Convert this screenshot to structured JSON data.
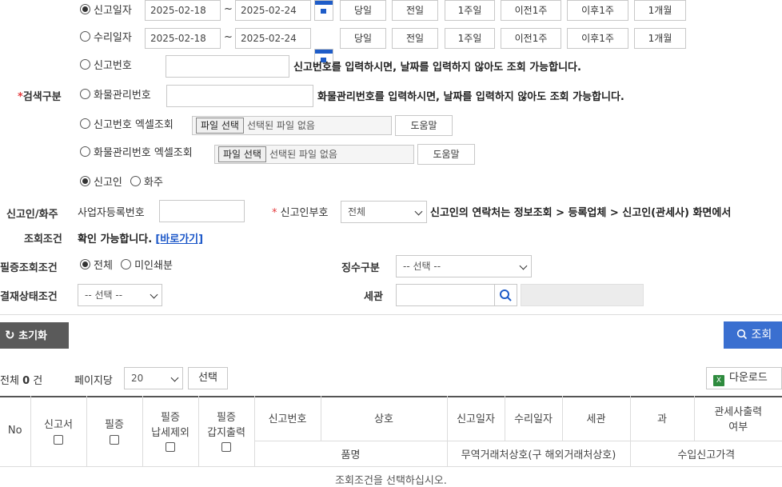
{
  "search_type": {
    "label": "검색구분",
    "report_date": {
      "radio_label": "신고일자",
      "from": "2025-02-18",
      "tilde": "~",
      "to": "2025-02-24"
    },
    "accept_date": {
      "radio_label": "수리일자",
      "from": "2025-02-18",
      "tilde": "~",
      "to": "2025-02-24"
    },
    "quick_buttons": [
      "당일",
      "전일",
      "1주일",
      "이전1주",
      "이후1주",
      "1개월"
    ],
    "report_no": {
      "radio_label": "신고번호",
      "notice": "신고번호를 입력하시면, 날짜를 입력하지 않아도 조회 가능합니다."
    },
    "cargo_no": {
      "radio_label": "화물관리번호",
      "notice": "화물관리번호를 입력하시면, 날짜를 입력하지 않아도 조회 가능합니다."
    },
    "report_excel": {
      "radio_label": "신고번호 엑셀조회",
      "file_button": "파일 선택",
      "file_status": "선택된 파일 없음",
      "help_button": "도움말"
    },
    "cargo_excel": {
      "radio_label": "화물관리번호 엑셀조회",
      "file_button": "파일 선택",
      "file_status": "선택된 파일 없음",
      "help_button": "도움말"
    }
  },
  "declarant": {
    "label_line1": "신고인/화주",
    "label_line2": "조회조건",
    "radio_declarant": "신고인",
    "radio_owner": "화주",
    "bizno_label": "사업자등록번호",
    "code_label": "신고인부호",
    "code_select": "전체",
    "notice_line1": "신고인의 연락처는 정보조회 > 등록업체 > 신고인(관세사) 화면에서",
    "notice_line2": "확인 가능합니다.",
    "link": "[바로가기]"
  },
  "cert": {
    "label": "필증조회조건",
    "radio_all": "전체",
    "radio_unprinted": "미인쇄분",
    "collection_label": "징수구분",
    "collection_select": "-- 선택 --"
  },
  "approval": {
    "label": "결재상태조건",
    "select": "-- 선택 --",
    "customs_label": "세관"
  },
  "actions": {
    "reset": "초기화",
    "search": "조회"
  },
  "list_bar": {
    "total_prefix": "전체",
    "total_count": "0",
    "total_suffix": "건",
    "per_page_label": "페이지당",
    "per_page_value": "20",
    "select_button": "선택",
    "download": "다운로드"
  },
  "table": {
    "headers": {
      "no": "No",
      "report_doc": "신고서",
      "cert": "필증",
      "cert_tax_excl_1": "필증",
      "cert_tax_excl_2": "납세제외",
      "cert_print_1": "필증",
      "cert_print_2": "갑지출력",
      "report_no": "신고번호",
      "company": "상호",
      "report_date": "신고일자",
      "accept_date": "수리일자",
      "customs": "세관",
      "section": "과",
      "broker_print_1": "관세사출력",
      "broker_print_2": "여부",
      "item_name": "품명",
      "trader": "무역거래처상호(구 해외거래처상호)",
      "import_price": "수입신고가격"
    },
    "empty_message": "조회조건을 선택하십시오."
  },
  "colors": {
    "accent_blue": "#1e5cc8",
    "search_button": "#3a6fd0",
    "reset_button": "#5a5a5a",
    "required_mark": "#e4393c"
  }
}
